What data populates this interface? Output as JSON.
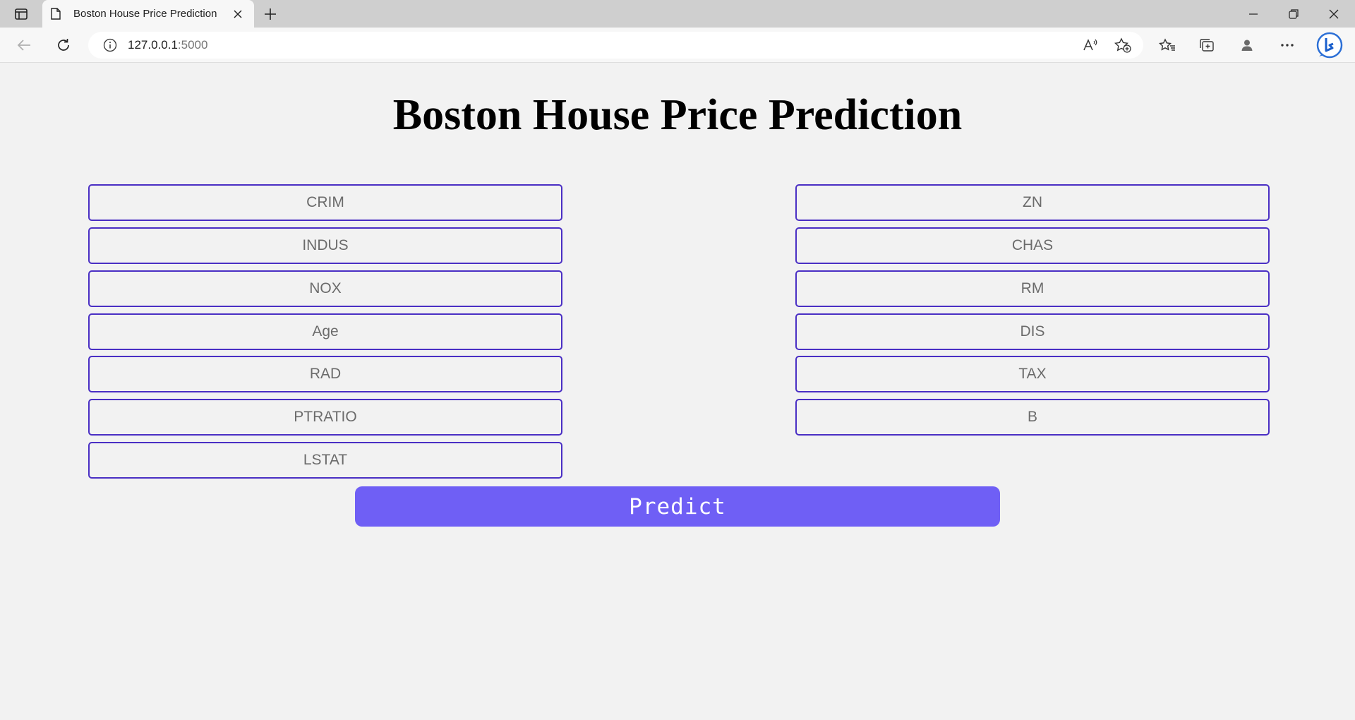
{
  "browser": {
    "tab_title": "Boston House Price Prediction",
    "address_host": "127.0.0.1",
    "address_port": ":5000"
  },
  "page": {
    "title": "Boston House Price Prediction",
    "fields_left": [
      "CRIM",
      "INDUS",
      "NOX",
      "Age",
      "RAD",
      "PTRATIO",
      "LSTAT"
    ],
    "fields_right": [
      "ZN",
      "CHAS",
      "RM",
      "DIS",
      "TAX",
      "B"
    ],
    "predict_label": "Predict"
  },
  "colors": {
    "accent": "#6f5ff5",
    "field_border": "#4a2fc4",
    "background": "#f2f2f2"
  }
}
